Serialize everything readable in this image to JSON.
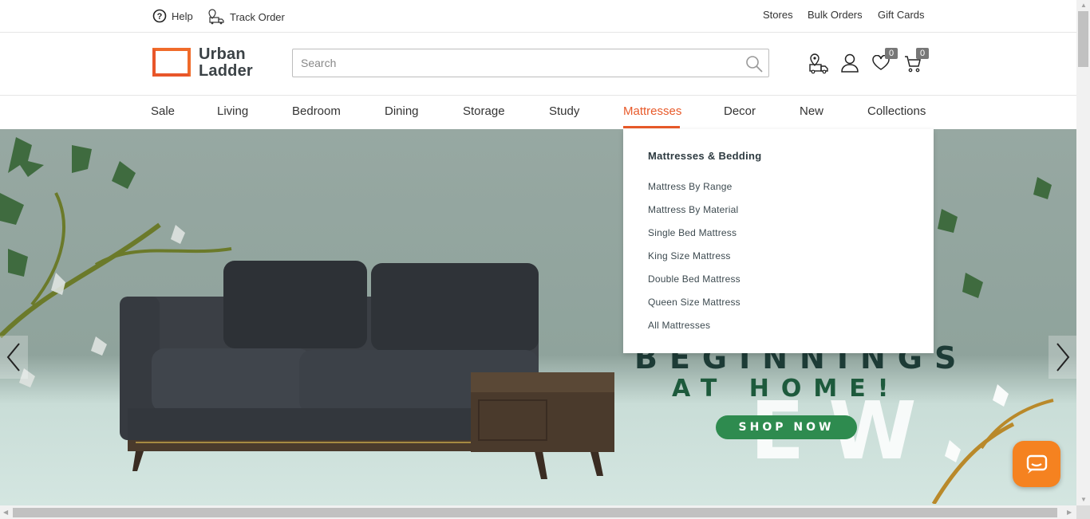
{
  "topbar": {
    "help": "Help",
    "track_order": "Track Order",
    "stores": "Stores",
    "bulk_orders": "Bulk Orders",
    "gift_cards": "Gift Cards"
  },
  "header": {
    "logo_line1": "Urban",
    "logo_line2": "Ladder",
    "search_placeholder": "Search",
    "wishlist_count": "0",
    "cart_count": "0"
  },
  "nav": {
    "items": [
      "Sale",
      "Living",
      "Bedroom",
      "Dining",
      "Storage",
      "Study",
      "Mattresses",
      "Decor",
      "New",
      "Collections"
    ],
    "active": "Mattresses"
  },
  "dropdown": {
    "heading": "Mattresses & Bedding",
    "links": [
      "Mattress By Range",
      "Mattress By Material",
      "Single Bed Mattress",
      "King Size Mattress",
      "Double Bed Mattress",
      "Queen Size Mattress",
      "All Mattresses"
    ]
  },
  "hero": {
    "big_word": "EW",
    "line1": "BEGINNINGS",
    "line2": "AT HOME!",
    "cta": "SHOP NOW"
  },
  "colors": {
    "accent": "#e85a2a",
    "cta_green": "#2e8b4f",
    "chat_orange": "#f58220"
  }
}
